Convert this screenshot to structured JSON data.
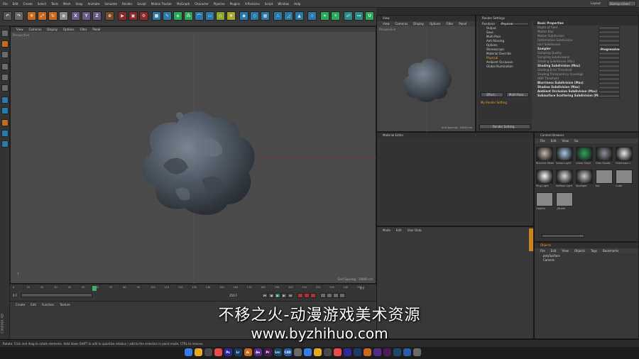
{
  "menubar": {
    "items": [
      "File",
      "Edit",
      "Create",
      "Select",
      "Tools",
      "Mesh",
      "Snap",
      "Animate",
      "Simulate",
      "Render",
      "Sculpt",
      "Motion Tracker",
      "MoGraph",
      "Character",
      "Pipeline",
      "Plugins",
      "X-Particles",
      "Script",
      "Window",
      "Help"
    ],
    "layout_label": "Layout:",
    "layout_value": "Startup (User)"
  },
  "toolbar": {
    "x_axis": "X",
    "y_axis": "Y",
    "z_axis": "Z"
  },
  "viewport": {
    "menu": [
      "View",
      "Cameras",
      "Display",
      "Options",
      "Filter",
      "Panel"
    ],
    "label": "Perspective",
    "grid_spacing": "Grid Spacing : 10000 cm"
  },
  "timeline": {
    "ticks": [
      "0",
      "10",
      "20",
      "30",
      "40",
      "50",
      "60",
      "70",
      "80",
      "90",
      "100",
      "110",
      "120",
      "130",
      "140",
      "150",
      "160",
      "170",
      "180",
      "190",
      "200",
      "210",
      "220",
      "230",
      "240",
      "250"
    ],
    "start": "0 F",
    "current": "0 F",
    "end": "250 F"
  },
  "materials": {
    "menu": [
      "Create",
      "Edit",
      "Function",
      "Texture"
    ]
  },
  "view2": {
    "title": "View",
    "menu": [
      "View",
      "Cameras",
      "Display",
      "Options",
      "Filter",
      "Panel"
    ],
    "label": "Perspective",
    "grid_spacing": "Grid Spacing : 10000 cm"
  },
  "render_settings": {
    "title": "Render Settings",
    "renderer_label": "Renderer",
    "renderer_value": "Physical",
    "items": [
      "Output",
      "Save",
      "Multi-Pass",
      "Anti-Aliasing",
      "Options",
      "Stereoscopic",
      "Material Override",
      "Physical",
      "Ambient Occlusion",
      "Global Illumination"
    ],
    "active_item": "Physical",
    "effect_button": "Effect...",
    "multipass_button": "Multi-Pass...",
    "preset": "My Render Setting",
    "render_setting_button": "Render Setting...",
    "panel_title": "Basic Properties",
    "rows": [
      "Depth of Field",
      "Motion Blur",
      "Motion Subdivision",
      "Deformation Subdivision",
      "Hair Subdivision",
      "Sampler",
      "Sampling Quality",
      "Sampling Subdivisions",
      "Shading Subdivision (Min)",
      "Shading Subdivision (Max)",
      "Shading Error Threshold",
      "Shading Transparency Coverage",
      "HDR Threshold",
      "Blurriness Subdivision (Max)",
      "Shadow Subdivision (Max)",
      "Ambient Occlusion Subdivision (Max)",
      "Subsurface Scattering Subdivision (Max)"
    ],
    "sampler_value": "Progressive"
  },
  "material_editor": {
    "title": "Material Editor"
  },
  "content_browser": {
    "title": "Content Browser",
    "menu": [
      "File",
      "Edit",
      "View",
      "Go"
    ],
    "items": [
      "Brushed Metal",
      "Indoor Light",
      "Linear Dayli",
      "Grey Studio",
      "Overhead Li",
      "Ring Light",
      "Softbox Light",
      "Spotlight",
      "tex",
      "Cube",
      "Objects",
      "_Studio"
    ]
  },
  "attributes": {
    "menu": [
      "Mode",
      "Edit",
      "User Data"
    ]
  },
  "objects": {
    "title": "Objects",
    "menu": [
      "File",
      "Edit",
      "View",
      "Objects",
      "Tags",
      "Bookmarks"
    ],
    "rows": [
      "polySurface",
      "Camera"
    ]
  },
  "statusbar": {
    "text": "Rotate: Click and drag to rotate elements. Hold down SHIFT to add to quantize rotation / add to the selection in point mode, CTRL to remove."
  },
  "watermark": {
    "title": "不移之火-动漫游戏美术资源",
    "url": "www.byzhihuo.com"
  },
  "branding": {
    "logo_text": "CINEMA 4D"
  },
  "taskbar": {
    "dock": [
      "Ps",
      "Lr",
      "Ai",
      "Ae",
      "Pr",
      "Lrc",
      "C4D"
    ]
  }
}
